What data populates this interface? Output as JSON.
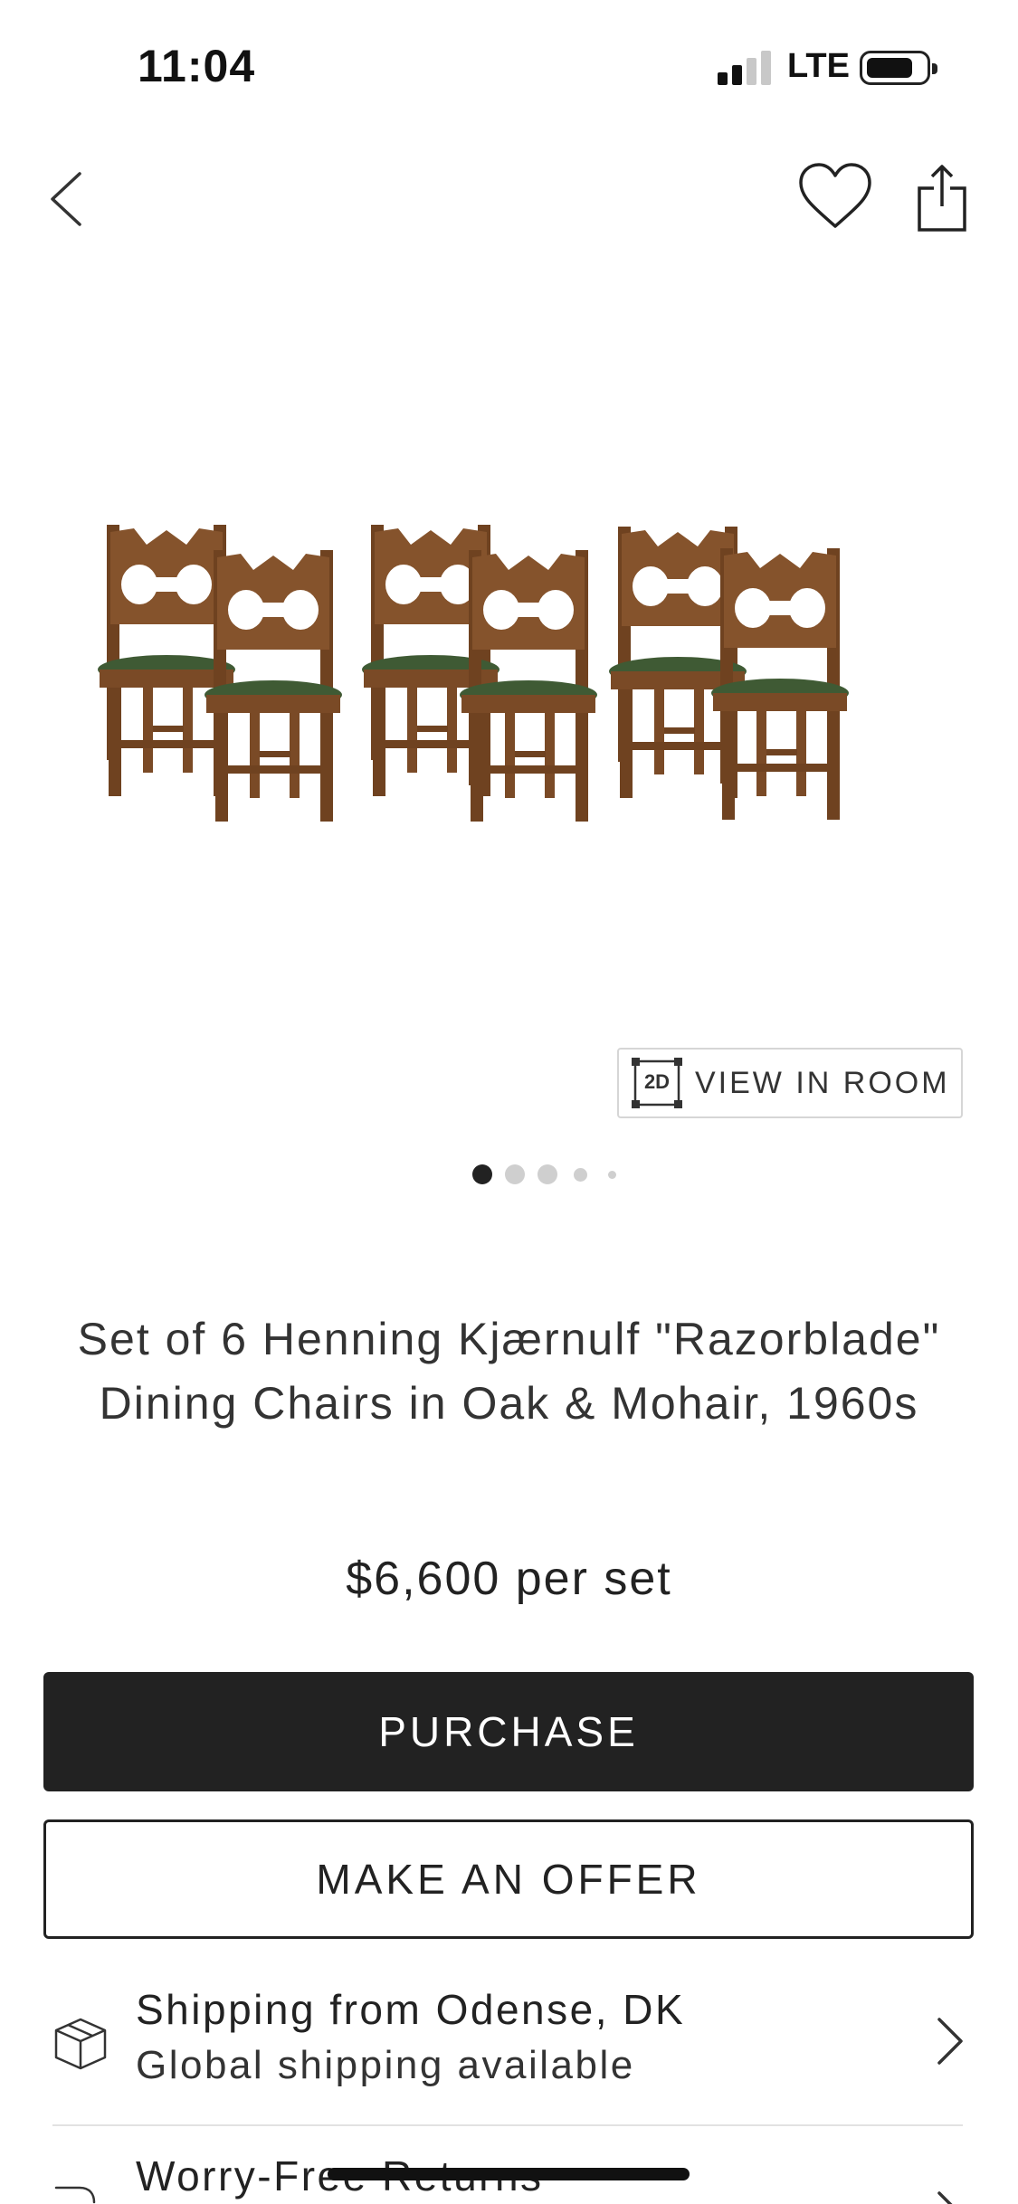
{
  "status_bar": {
    "time": "11:04",
    "network": "LTE",
    "signal_bars_active": 2,
    "signal_bars_total": 4
  },
  "nav": {
    "back_icon": "chevron-left-icon",
    "favorite_icon": "heart-icon",
    "share_icon": "share-icon"
  },
  "gallery": {
    "image_subject": "six oak dining chairs with green mohair seats",
    "view_in_room_badge": "2D",
    "view_in_room_label": "VIEW IN ROOM",
    "page_count": 5,
    "active_page": 0
  },
  "product": {
    "title": "Set of 6 Henning Kjærnulf \"Razorblade\" Dining Chairs in Oak & Mohair, 1960s",
    "price": "$6,600 per set"
  },
  "actions": {
    "purchase_label": "PURCHASE",
    "offer_label": "MAKE AN OFFER"
  },
  "shipping": {
    "title": "Shipping from Odense, DK",
    "subtitle": "Global shipping available"
  },
  "returns": {
    "title": "Worry-Free Returns"
  },
  "colors": {
    "primary_button": "#222222",
    "text": "#222222",
    "wood": "#7a4a26",
    "seat_green": "#3f5a34"
  }
}
